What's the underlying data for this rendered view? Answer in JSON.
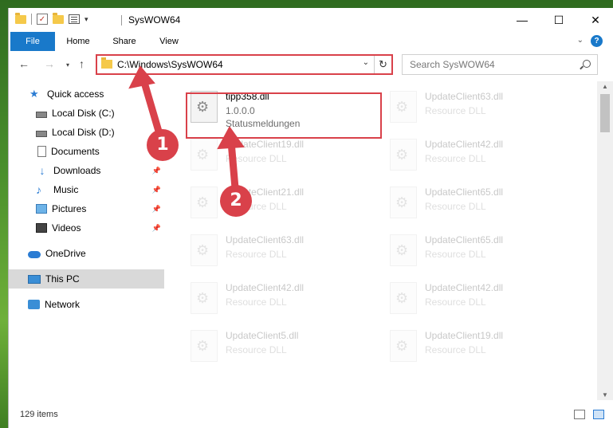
{
  "window": {
    "title": "SysWOW64"
  },
  "window_buttons": {
    "minimize": "—",
    "maximize": "☐",
    "close": "✕"
  },
  "ribbon": {
    "tabs": [
      "File",
      "Home",
      "Share",
      "View"
    ],
    "help": "?"
  },
  "address": {
    "path": "C:\\Windows\\SysWOW64",
    "search_placeholder": "Search SysWOW64"
  },
  "sidebar": {
    "items": [
      {
        "label": "Quick access"
      },
      {
        "label": "Local Disk (C:)"
      },
      {
        "label": "Local Disk (D:)"
      },
      {
        "label": "Documents"
      },
      {
        "label": "Downloads"
      },
      {
        "label": "Music"
      },
      {
        "label": "Pictures"
      },
      {
        "label": "Videos"
      },
      {
        "label": "OneDrive"
      },
      {
        "label": "This PC"
      },
      {
        "label": "Network"
      }
    ]
  },
  "files": [
    {
      "name": "tipp358.dll",
      "line2": "1.0.0.0",
      "line3": "Statusmeldungen"
    },
    {
      "name": "UpdateClient63.dll",
      "line2": "Resource DLL"
    },
    {
      "name": "UpdateClient19.dll",
      "line2": "Resource DLL"
    },
    {
      "name": "UpdateClient42.dll",
      "line2": "Resource DLL"
    },
    {
      "name": "UpdateClient21.dll",
      "line2": "Resource DLL"
    },
    {
      "name": "UpdateClient65.dll",
      "line2": "Resource DLL"
    },
    {
      "name": "UpdateClient63.dll",
      "line2": "Resource DLL"
    },
    {
      "name": "UpdateClient65.dll",
      "line2": "Resource DLL"
    },
    {
      "name": "UpdateClient42.dll",
      "line2": "Resource DLL"
    },
    {
      "name": "UpdateClient42.dll",
      "line2": "Resource DLL"
    },
    {
      "name": "UpdateClient5.dll",
      "line2": "Resource DLL"
    },
    {
      "name": "UpdateClient19.dll",
      "line2": "Resource DLL"
    }
  ],
  "status": {
    "item_count": "129 items"
  },
  "annotations": {
    "step1": "1",
    "step2": "2"
  },
  "colors": {
    "accent": "#1979ca",
    "highlight": "#d9414a"
  }
}
